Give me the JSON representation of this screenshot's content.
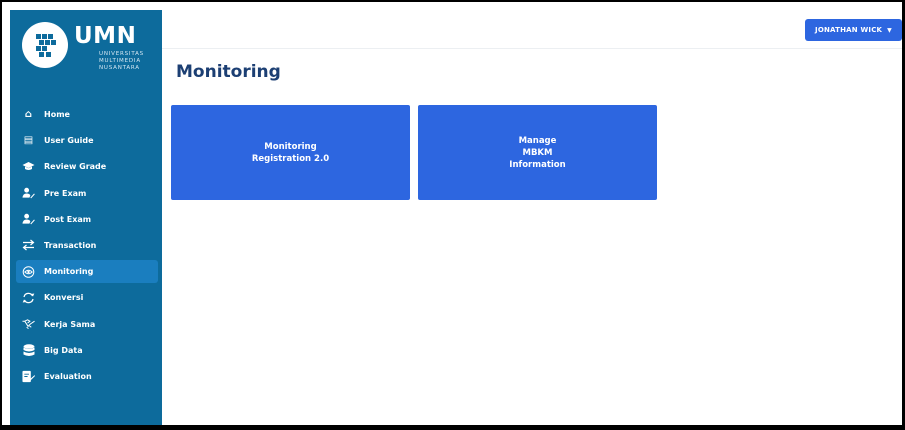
{
  "app": {
    "logo_title": "UMN",
    "logo_subtitle": [
      "UNIVERSITAS",
      "MULTIMEDIA",
      "NUSANTARA"
    ]
  },
  "header": {
    "user_label": "JONATHAN WICK",
    "user_caret": "▼"
  },
  "page": {
    "title": "Monitoring"
  },
  "sidebar": {
    "items": [
      {
        "label": "Home",
        "icon": "home-icon",
        "glyph": "⌂",
        "active": false
      },
      {
        "label": "User Guide",
        "icon": "book-icon",
        "glyph": "▤",
        "active": false
      },
      {
        "label": "Review Grade",
        "icon": "graduation-cap-icon",
        "glyph": "🎓",
        "active": false
      },
      {
        "label": "Pre Exam",
        "icon": "user-edit-icon",
        "glyph": "✎",
        "active": false
      },
      {
        "label": "Post Exam",
        "icon": "user-edit-icon",
        "glyph": "✎",
        "active": false
      },
      {
        "label": "Transaction",
        "icon": "transfer-arrows-icon",
        "glyph": "⇄",
        "active": false
      },
      {
        "label": "Monitoring",
        "icon": "eye-icon",
        "glyph": "◎",
        "active": true
      },
      {
        "label": "Konversi",
        "icon": "refresh-icon",
        "glyph": "↻",
        "active": false
      },
      {
        "label": "Kerja Sama",
        "icon": "handshake-icon",
        "glyph": "⚇",
        "active": false
      },
      {
        "label": "Big Data",
        "icon": "database-icon",
        "glyph": "☰",
        "active": false
      },
      {
        "label": "Evaluation",
        "icon": "checklist-icon",
        "glyph": "✓",
        "active": false
      }
    ]
  },
  "cards": [
    {
      "label": "Monitoring\nRegistration 2.0"
    },
    {
      "label": "Manage\nMBKM\nInformation"
    }
  ],
  "colors": {
    "sidebar_bg": "#0d6b9c",
    "accent": "#2d66e0",
    "title": "#1c3f73"
  }
}
